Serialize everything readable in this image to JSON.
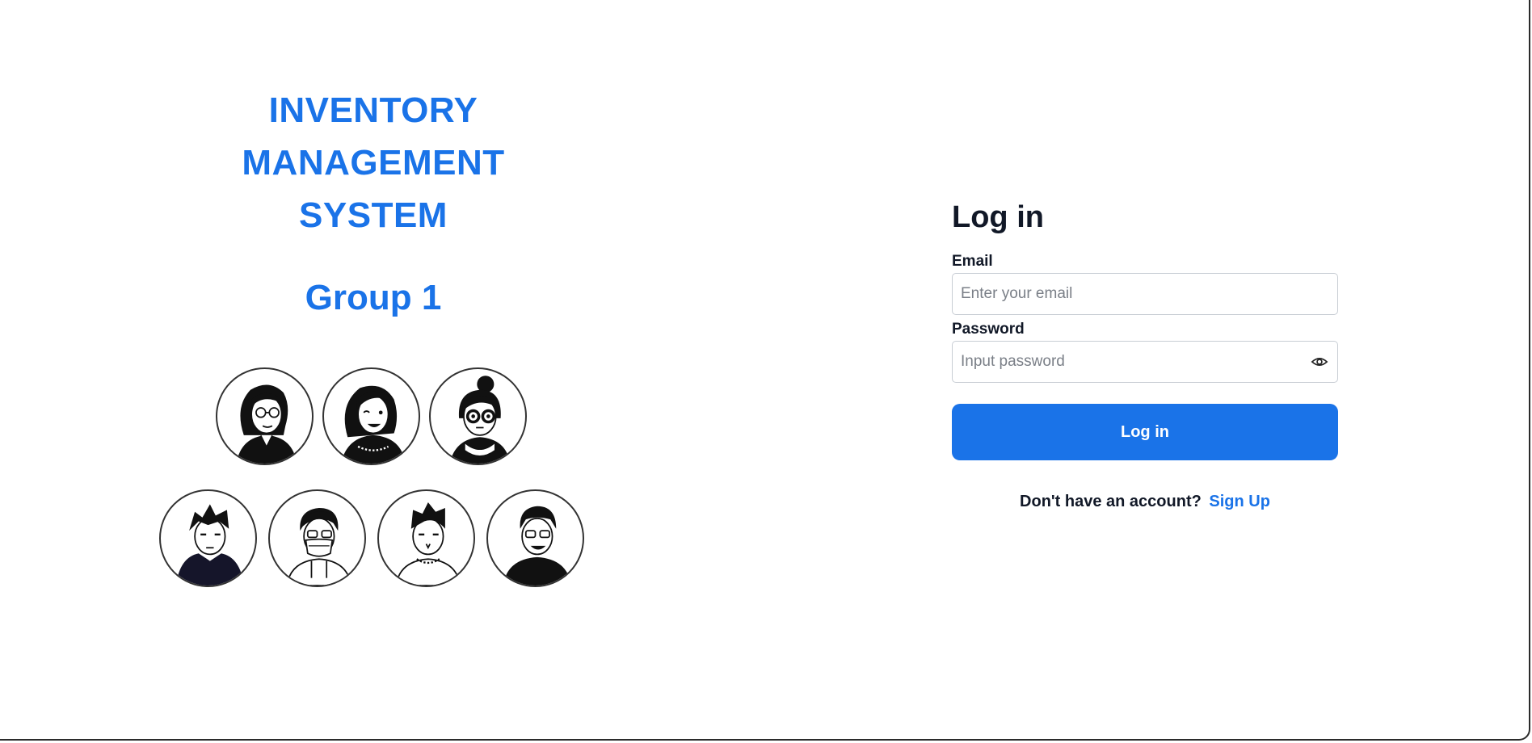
{
  "brand": {
    "title_lines": [
      "INVENTORY",
      "MANAGEMENT",
      "SYSTEM"
    ],
    "group": "Group 1",
    "accent_color": "#1a73e8"
  },
  "team": {
    "members": [
      {
        "icon": "avatar-woman-long-hair-glasses-icon"
      },
      {
        "icon": "avatar-woman-smiling-icon"
      },
      {
        "icon": "avatar-woman-bun-glasses-icon"
      },
      {
        "icon": "avatar-man-hoodie-icon"
      },
      {
        "icon": "avatar-man-mask-glasses-icon"
      },
      {
        "icon": "avatar-man-sweater-icon"
      },
      {
        "icon": "avatar-man-glasses-smiling-icon"
      }
    ]
  },
  "login": {
    "heading": "Log in",
    "email_label": "Email",
    "email_placeholder": "Enter your email",
    "email_value": "",
    "password_label": "Password",
    "password_placeholder": "Input password",
    "password_value": "",
    "password_toggle_icon": "eye-icon",
    "submit_label": "Log in",
    "signup_prompt": "Don't have an account?",
    "signup_link": "Sign Up",
    "button_color": "#1a73e8"
  }
}
